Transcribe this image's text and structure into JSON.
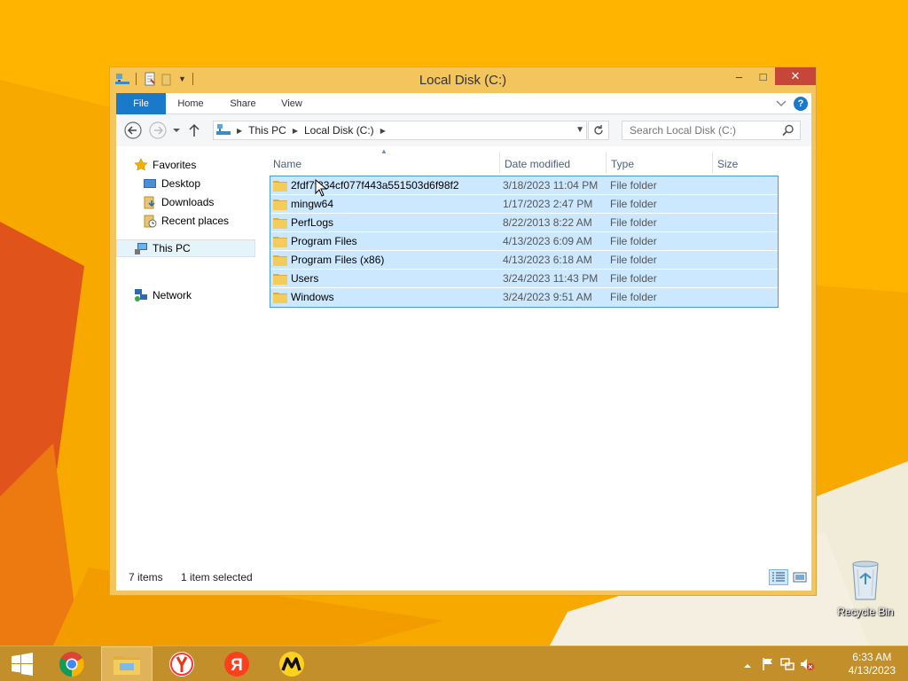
{
  "window": {
    "title": "Local Disk (C:)",
    "controls": {
      "minimize": "–",
      "maximize": "□",
      "close": "✕"
    }
  },
  "ribbon": {
    "tabs": [
      "File",
      "Home",
      "Share",
      "View"
    ]
  },
  "navigation": {
    "breadcrumb": [
      "This PC",
      "Local Disk (C:)"
    ],
    "search_placeholder": "Search Local Disk (C:)"
  },
  "nav_pane": {
    "favorites_label": "Favorites",
    "favorites": [
      "Desktop",
      "Downloads",
      "Recent places"
    ],
    "this_pc_label": "This PC",
    "network_label": "Network"
  },
  "columns": {
    "name": "Name",
    "date": "Date modified",
    "type": "Type",
    "size": "Size"
  },
  "files": [
    {
      "name": "2fdf7f834cf077f443a551503d6f98f2",
      "date": "3/18/2023 11:04 PM",
      "type": "File folder"
    },
    {
      "name": "mingw64",
      "date": "1/17/2023 2:47 PM",
      "type": "File folder"
    },
    {
      "name": "PerfLogs",
      "date": "8/22/2013 8:22 AM",
      "type": "File folder"
    },
    {
      "name": "Program Files",
      "date": "4/13/2023 6:09 AM",
      "type": "File folder"
    },
    {
      "name": "Program Files (x86)",
      "date": "4/13/2023 6:18 AM",
      "type": "File folder"
    },
    {
      "name": "Users",
      "date": "3/24/2023 11:43 PM",
      "type": "File folder"
    },
    {
      "name": "Windows",
      "date": "3/24/2023 9:51 AM",
      "type": "File folder"
    }
  ],
  "status": {
    "items": "7 items",
    "selected": "1 item selected"
  },
  "desktop": {
    "recycle_bin_label": "Recycle Bin"
  },
  "taskbar": {
    "apps": [
      "start-icon",
      "chrome-icon",
      "file-explorer-icon",
      "yandex-browser-icon",
      "yandex-icon",
      "yandex-market-icon"
    ],
    "time": "6:33 AM",
    "date": "4/13/2023"
  },
  "colors": {
    "accent": "#1979ca",
    "selection": "#cce8ff",
    "desktop": "#f7a800",
    "taskbar": "#c28f2a"
  }
}
